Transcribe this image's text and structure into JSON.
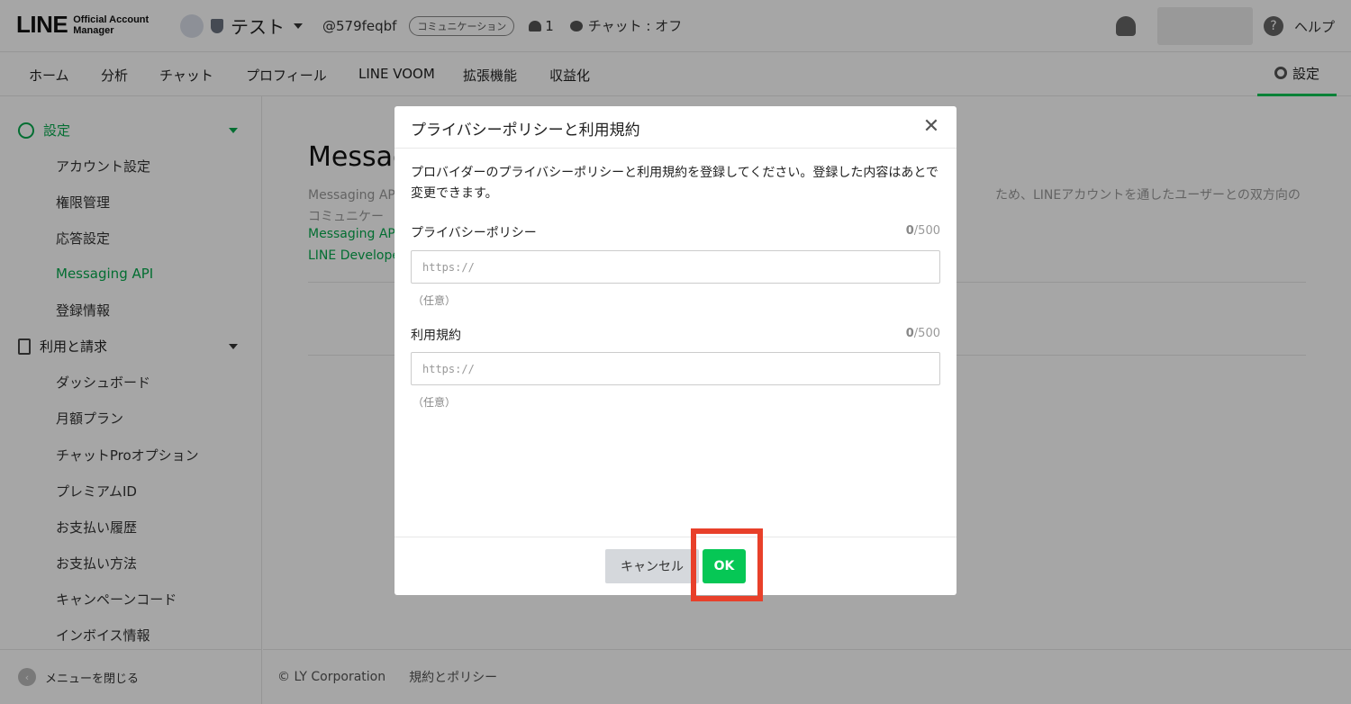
{
  "header": {
    "logo_main": "LINE",
    "logo_sub_1": "Official Account",
    "logo_sub_2": "Manager",
    "account_name": "テスト",
    "account_id": "@579feqbf",
    "badge": "コミュニケーション",
    "friends_count": "1",
    "chat_status": "チャット : オフ",
    "help": "ヘルプ"
  },
  "nav": {
    "items": [
      "ホーム",
      "分析",
      "チャット",
      "プロフィール",
      "LINE VOOM",
      "拡張機能",
      "収益化"
    ],
    "settings": "設定"
  },
  "sidebar": {
    "section1": "設定",
    "section1_items": [
      "アカウント設定",
      "権限管理",
      "応答設定",
      "Messaging API",
      "登録情報"
    ],
    "section2": "利用と請求",
    "section2_items": [
      "ダッシュボード",
      "月額プラン",
      "チャットProオプション",
      "プレミアムID",
      "お支払い履歴",
      "お支払い方法",
      "キャンペーンコード",
      "インボイス情報"
    ],
    "close_menu": "メニューを閉じる"
  },
  "main": {
    "title": "Messag",
    "desc_line1_left": "Messaging AP",
    "desc_line1_right": "ため、LINEアカウントを通したユーザーとの双方向の",
    "desc_line2": "コミュニケー",
    "link1": "Messaging AP",
    "link2": "LINE Develope",
    "footer_copyright": "© LY Corporation",
    "footer_policy": "規約とポリシー"
  },
  "modal": {
    "title": "プライバシーポリシーと利用規約",
    "description": "プロバイダーのプライバシーポリシーと利用規約を登録してください。登録した内容はあとで変更できます。",
    "privacy_label": "プライバシーポリシー",
    "privacy_count": "0",
    "privacy_max": "/500",
    "privacy_placeholder": "https://",
    "privacy_optional": "（任意）",
    "terms_label": "利用規約",
    "terms_count": "0",
    "terms_max": "/500",
    "terms_placeholder": "https://",
    "terms_optional": "（任意）",
    "cancel": "キャンセル",
    "ok": "OK"
  }
}
